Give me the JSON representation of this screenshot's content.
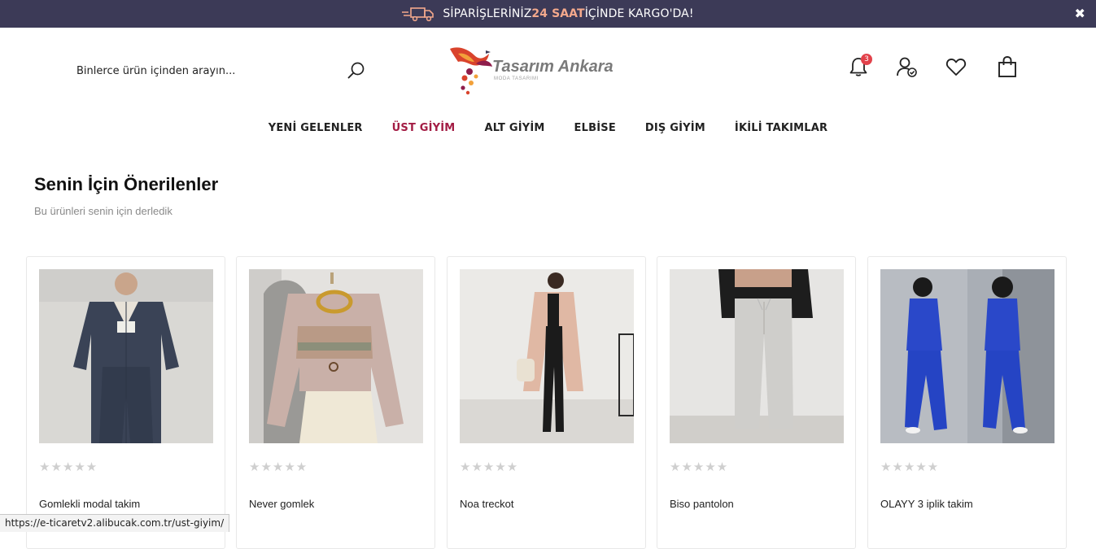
{
  "announcement": {
    "prefix": "SİPARİŞLERİNİZ ",
    "highlight": "24 SAAT",
    "suffix": " İÇİNDE KARGO'DA!",
    "close_label": "✖"
  },
  "header": {
    "search_placeholder": "Binlerce ürün içinden arayın...",
    "logo_text": "Tasarım Ankara",
    "logo_tagline": "MODA TASARIMI",
    "notification_count": "3"
  },
  "nav": {
    "items": [
      {
        "label": "YENİ GELENLER"
      },
      {
        "label": "ÜST GİYİM"
      },
      {
        "label": "ALT GİYİM"
      },
      {
        "label": "ELBİSE"
      },
      {
        "label": "DIŞ GİYİM"
      },
      {
        "label": "İKİLİ TAKIMLAR"
      }
    ],
    "active_index": 1
  },
  "section": {
    "title": "Senin İçin Önerilenler",
    "subtitle": "Bu ürünleri senin için derledik"
  },
  "products": [
    {
      "name": "Gomlekli modal takim",
      "stars": "★★★★★"
    },
    {
      "name": "Never gomlek",
      "stars": "★★★★★"
    },
    {
      "name": "Noa treckot",
      "stars": "★★★★★"
    },
    {
      "name": "Biso pantolon",
      "stars": "★★★★★"
    },
    {
      "name": "OLAYY 3 iplik takim",
      "stars": "★★★★★"
    }
  ],
  "status_url": "https://e-ticaretv2.alibucak.com.tr/ust-giyim/",
  "colors": {
    "topbar": "#3c3a57",
    "highlight": "#f4a98c",
    "active_nav": "#a31c44",
    "badge": "#e2424b"
  }
}
